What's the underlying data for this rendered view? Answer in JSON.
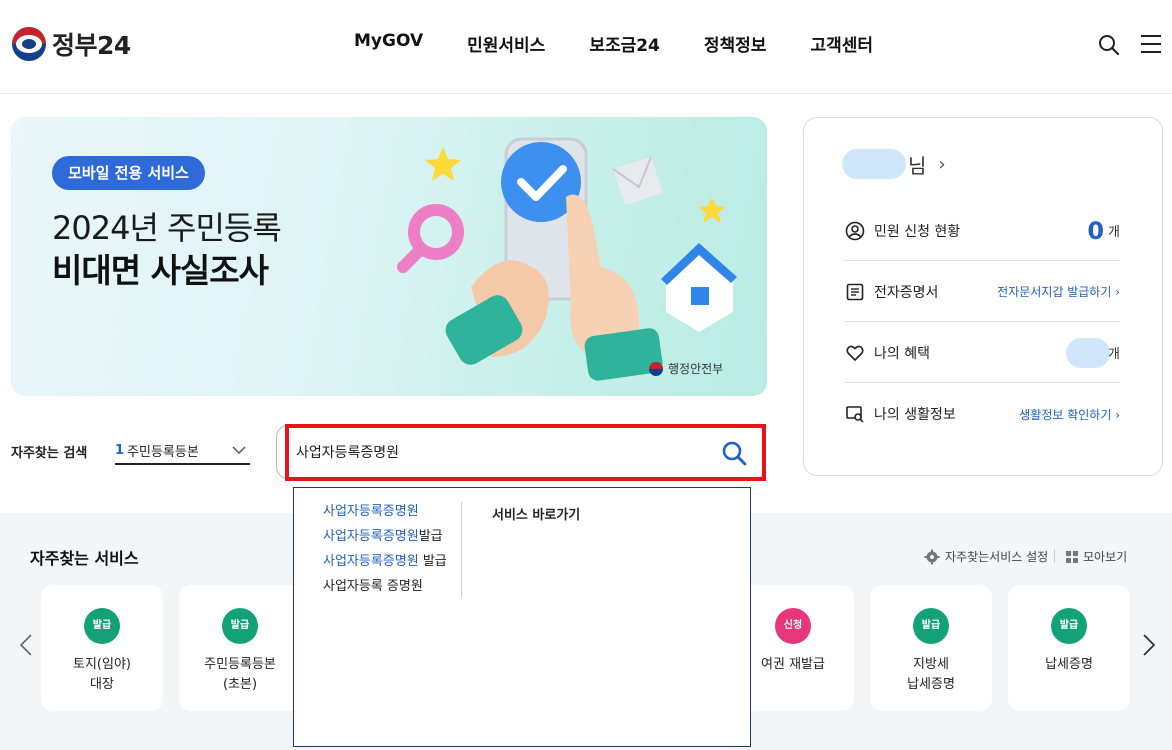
{
  "header": {
    "logo_text": "정부24",
    "nav": [
      "MyGOV",
      "민원서비스",
      "보조금24",
      "정책정보",
      "고객센터"
    ]
  },
  "banner": {
    "badge": "모바일 전용 서비스",
    "title_line1": "2024년 주민등록",
    "title_line2": "비대면 사실조사",
    "org": "행정안전부"
  },
  "user_panel": {
    "name_suffix": "님",
    "rows": [
      {
        "label": "민원 신청 현황",
        "count": "0",
        "unit": "개"
      },
      {
        "label": "전자증명서",
        "link": "전자문서지갑 발급하기 ›"
      },
      {
        "label": "나의 혜택",
        "unit": "개"
      },
      {
        "label": "나의 생활정보",
        "link": "생활정보 확인하기 ›"
      }
    ]
  },
  "frequent_search": {
    "label": "자주찾는 검색",
    "rank": "1",
    "selected": "주민등록등본"
  },
  "search": {
    "value": "사업자등록증명원"
  },
  "autocomplete": {
    "items": [
      {
        "blue": "사업자등록증명원",
        "dark": ""
      },
      {
        "blue": "사업자등록증명원",
        "dark": "발급"
      },
      {
        "blue": "사업자등록증명원",
        "dark": " 발급"
      },
      {
        "blue": "",
        "dark": "사업자등록 증명원"
      }
    ],
    "side_title": "서비스 바로가기"
  },
  "services": {
    "title": "자주찾는 서비스",
    "settings_label": "자주찾는서비스 설정",
    "more_label": "모아보기",
    "cards": [
      {
        "badge": "발급",
        "type": "issue",
        "line1": "토지(임야)",
        "line2": "대장"
      },
      {
        "badge": "발급",
        "type": "issue",
        "line1": "주민등록등본",
        "line2": "(초본)"
      },
      {
        "badge": "신청",
        "type": "apply",
        "line1": "여권 재발급",
        "line2": ""
      },
      {
        "badge": "발급",
        "type": "issue",
        "line1": "지방세",
        "line2": "납세증명"
      },
      {
        "badge": "발급",
        "type": "issue",
        "line1": "납세증명",
        "line2": ""
      }
    ]
  },
  "colors": {
    "accent_blue": "#2160c4",
    "highlight_red": "#e8141a",
    "issue_green": "#13a277",
    "apply_pink": "#e8367a"
  }
}
